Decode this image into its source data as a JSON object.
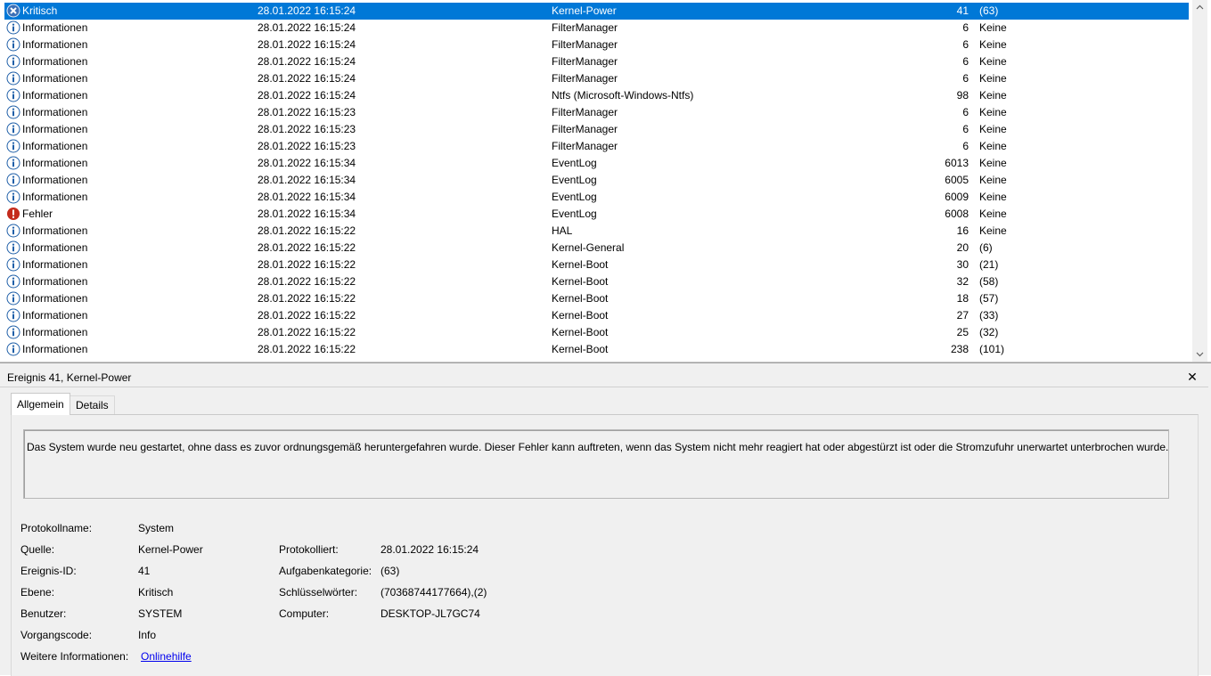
{
  "events": [
    {
      "level": "Kritisch",
      "icon": "critical-icon",
      "date": "28.01.2022 16:15:24",
      "source": "Kernel-Power",
      "id": "41",
      "task": "(63)",
      "selected": true
    },
    {
      "level": "Informationen",
      "icon": "info-icon",
      "date": "28.01.2022 16:15:24",
      "source": "FilterManager",
      "id": "6",
      "task": "Keine"
    },
    {
      "level": "Informationen",
      "icon": "info-icon",
      "date": "28.01.2022 16:15:24",
      "source": "FilterManager",
      "id": "6",
      "task": "Keine"
    },
    {
      "level": "Informationen",
      "icon": "info-icon",
      "date": "28.01.2022 16:15:24",
      "source": "FilterManager",
      "id": "6",
      "task": "Keine"
    },
    {
      "level": "Informationen",
      "icon": "info-icon",
      "date": "28.01.2022 16:15:24",
      "source": "FilterManager",
      "id": "6",
      "task": "Keine"
    },
    {
      "level": "Informationen",
      "icon": "info-icon",
      "date": "28.01.2022 16:15:24",
      "source": "Ntfs (Microsoft-Windows-Ntfs)",
      "id": "98",
      "task": "Keine"
    },
    {
      "level": "Informationen",
      "icon": "info-icon",
      "date": "28.01.2022 16:15:23",
      "source": "FilterManager",
      "id": "6",
      "task": "Keine"
    },
    {
      "level": "Informationen",
      "icon": "info-icon",
      "date": "28.01.2022 16:15:23",
      "source": "FilterManager",
      "id": "6",
      "task": "Keine"
    },
    {
      "level": "Informationen",
      "icon": "info-icon",
      "date": "28.01.2022 16:15:23",
      "source": "FilterManager",
      "id": "6",
      "task": "Keine"
    },
    {
      "level": "Informationen",
      "icon": "info-icon",
      "date": "28.01.2022 16:15:34",
      "source": "EventLog",
      "id": "6013",
      "task": "Keine"
    },
    {
      "level": "Informationen",
      "icon": "info-icon",
      "date": "28.01.2022 16:15:34",
      "source": "EventLog",
      "id": "6005",
      "task": "Keine"
    },
    {
      "level": "Informationen",
      "icon": "info-icon",
      "date": "28.01.2022 16:15:34",
      "source": "EventLog",
      "id": "6009",
      "task": "Keine"
    },
    {
      "level": "Fehler",
      "icon": "error-icon",
      "date": "28.01.2022 16:15:34",
      "source": "EventLog",
      "id": "6008",
      "task": "Keine"
    },
    {
      "level": "Informationen",
      "icon": "info-icon",
      "date": "28.01.2022 16:15:22",
      "source": "HAL",
      "id": "16",
      "task": "Keine"
    },
    {
      "level": "Informationen",
      "icon": "info-icon",
      "date": "28.01.2022 16:15:22",
      "source": "Kernel-General",
      "id": "20",
      "task": "(6)"
    },
    {
      "level": "Informationen",
      "icon": "info-icon",
      "date": "28.01.2022 16:15:22",
      "source": "Kernel-Boot",
      "id": "30",
      "task": "(21)"
    },
    {
      "level": "Informationen",
      "icon": "info-icon",
      "date": "28.01.2022 16:15:22",
      "source": "Kernel-Boot",
      "id": "32",
      "task": "(58)"
    },
    {
      "level": "Informationen",
      "icon": "info-icon",
      "date": "28.01.2022 16:15:22",
      "source": "Kernel-Boot",
      "id": "18",
      "task": "(57)"
    },
    {
      "level": "Informationen",
      "icon": "info-icon",
      "date": "28.01.2022 16:15:22",
      "source": "Kernel-Boot",
      "id": "27",
      "task": "(33)"
    },
    {
      "level": "Informationen",
      "icon": "info-icon",
      "date": "28.01.2022 16:15:22",
      "source": "Kernel-Boot",
      "id": "25",
      "task": "(32)"
    },
    {
      "level": "Informationen",
      "icon": "info-icon",
      "date": "28.01.2022 16:15:22",
      "source": "Kernel-Boot",
      "id": "238",
      "task": "(101)"
    }
  ],
  "colors": {
    "selection": "#0078d7",
    "info": "#1f5fa8",
    "error": "#c42b1c",
    "critical": "#3b6fb6"
  },
  "detail": {
    "title": "Ereignis 41, Kernel-Power",
    "close_label": "✕",
    "tabs": {
      "general": "Allgemein",
      "details": "Details"
    },
    "description": "Das System wurde neu gestartet, ohne dass es zuvor ordnungsgemäß heruntergefahren wurde. Dieser Fehler kann auftreten, wenn das System nicht mehr reagiert hat oder abgestürzt ist oder die Stromzufuhr unerwartet unterbrochen wurde.",
    "labels": {
      "log_name": "Protokollname:",
      "source": "Quelle:",
      "event_id": "Ereignis-ID:",
      "level": "Ebene:",
      "user": "Benutzer:",
      "opcode": "Vorgangscode:",
      "more_info": "Weitere Informationen:",
      "logged": "Protokolliert:",
      "task_category": "Aufgabenkategorie:",
      "keywords": "Schlüsselwörter:",
      "computer": "Computer:"
    },
    "values": {
      "log_name": "System",
      "source": "Kernel-Power",
      "event_id": "41",
      "level": "Kritisch",
      "user": "SYSTEM",
      "opcode": "Info",
      "more_info_link": "Onlinehilfe",
      "logged": "28.01.2022 16:15:24",
      "task_category": "(63)",
      "keywords": "(70368744177664),(2)",
      "computer": "DESKTOP-JL7GC74"
    }
  }
}
